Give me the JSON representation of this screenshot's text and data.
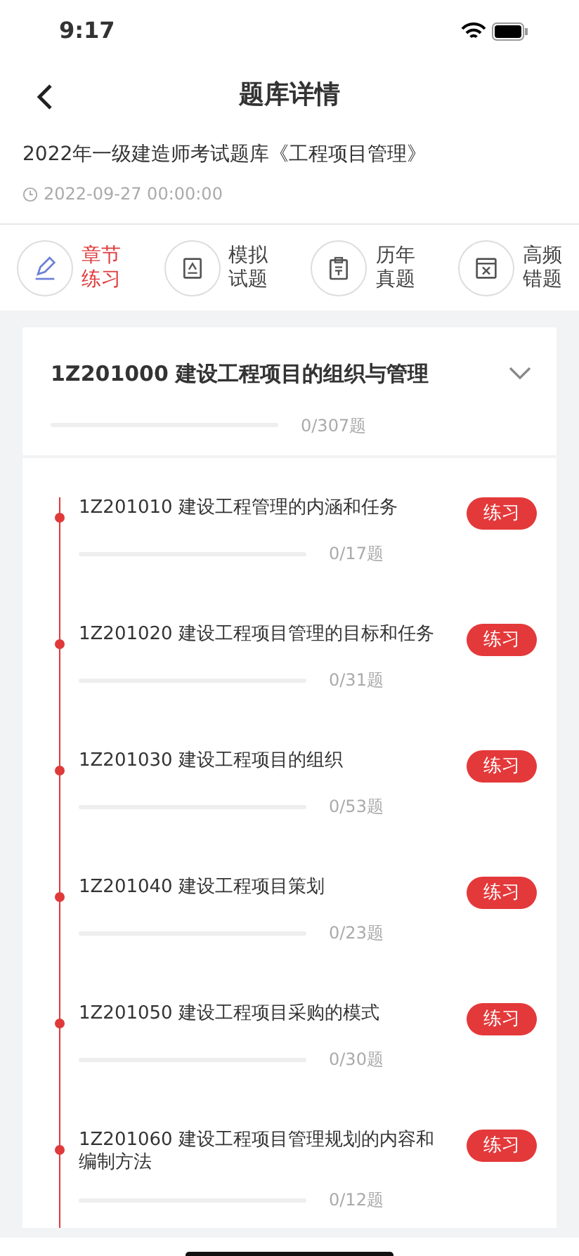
{
  "status_bar": {
    "time": "9:17"
  },
  "nav": {
    "title": "题库详情"
  },
  "exam": {
    "title": "2022年一级建造师考试题库《工程项目管理》",
    "date": "2022-09-27 00:00:00"
  },
  "tabs": [
    {
      "kind": "pencil",
      "line1": "章节",
      "line2": "练习",
      "selected": true
    },
    {
      "kind": "paper",
      "line1": "模拟",
      "line2": "试题",
      "selected": false
    },
    {
      "kind": "clipboard",
      "line1": "历年",
      "line2": "真题",
      "selected": false
    },
    {
      "kind": "wrong",
      "line1": "高频",
      "line2": "错题",
      "selected": false
    }
  ],
  "chapter": {
    "title": "1Z201000 建设工程项目的组织与管理",
    "expanded": true,
    "level": 0,
    "count": "0/307题",
    "sections": [
      {
        "title": "1Z201010 建设工程管理的内涵和任务",
        "level": 0,
        "count": "0/17题",
        "action": "练习"
      },
      {
        "title": "1Z201020 建设工程项目管理的目标和任务",
        "level": 0,
        "count": "0/31题",
        "action": "练习"
      },
      {
        "title": "1Z201030 建设工程项目的组织",
        "level": 0,
        "count": "0/53题",
        "action": "练习"
      },
      {
        "title": "1Z201040 建设工程项目策划",
        "level": 0,
        "count": "0/23题",
        "action": "练习"
      },
      {
        "title": "1Z201050 建设工程项目采购的模式",
        "level": 0,
        "count": "0/30题",
        "action": "练习"
      },
      {
        "title": "1Z201060 建设工程项目管理规划的内容和编制方法",
        "level": 0,
        "count": "0/12题",
        "action": "练习"
      }
    ]
  }
}
